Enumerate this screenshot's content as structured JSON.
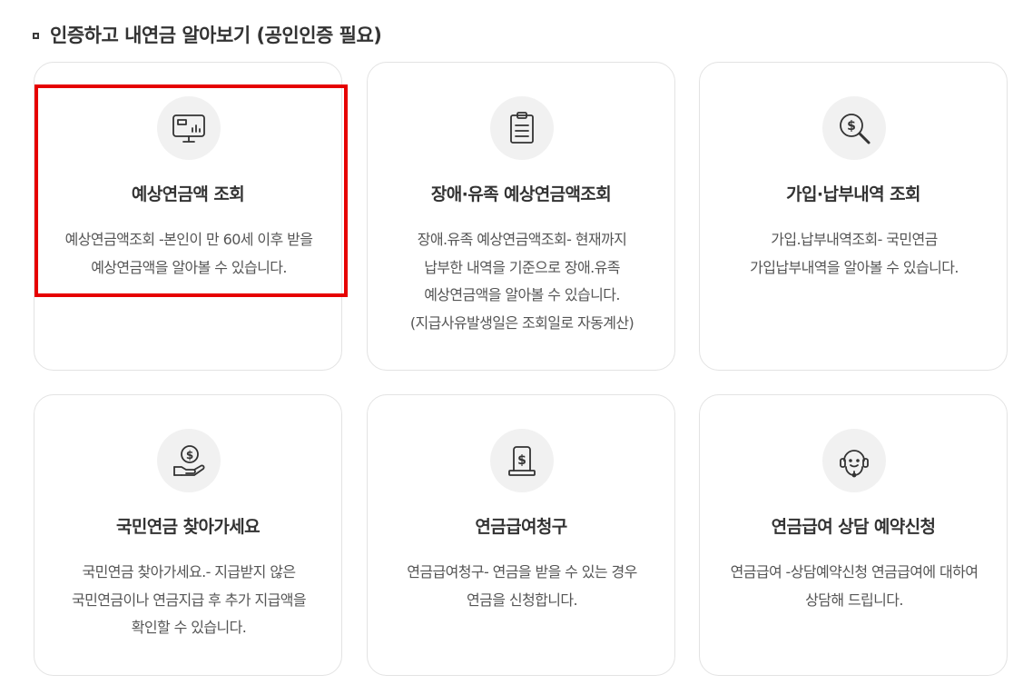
{
  "section": {
    "title": "인증하고 내연금 알아보기 (공인인증 필요)"
  },
  "cards": [
    {
      "icon": "monitor-chart-icon",
      "title": "예상연금액 조회",
      "desc": [
        "예상연금액조회 -본인이 만 60세 이후 받을",
        "예상연금액을 알아볼 수 있습니다."
      ]
    },
    {
      "icon": "clipboard-icon",
      "title": "장애·유족 예상연금액조회",
      "desc": [
        "장애.유족 예상연금액조회- 현재까지",
        "납부한 내역을 기준으로 장애.유족",
        "예상연금액을 알아볼 수 있습니다.",
        "(지급사유발생일은 조회일로 자동계산)"
      ]
    },
    {
      "icon": "dollar-search-icon",
      "title": "가입·납부내역 조회",
      "desc": [
        "가입.납부내역조회- 국민연금",
        "가입납부내역을 알아볼 수 있습니다."
      ]
    },
    {
      "icon": "coin-hand-icon",
      "title": "국민연금 찾아가세요",
      "desc": [
        "국민연금 찾아가세요.- 지급받지 않은",
        "국민연금이나 연금지급 후 추가 지급액을",
        "확인할 수 있습니다."
      ]
    },
    {
      "icon": "dollar-document-icon",
      "title": "연금급여청구",
      "desc": [
        "연금급여청구- 연금을 받을 수 있는 경우",
        "연금을 신청합니다."
      ]
    },
    {
      "icon": "headset-icon",
      "title": "연금급여 상담 예약신청",
      "desc": [
        "연금급여 -상담예약신청 연금급여에 대하여",
        "상담해 드립니다."
      ]
    }
  ],
  "colors": {
    "highlight": "#e60000",
    "card_border": "#e3e3e3",
    "icon_bg": "#f1f1f1"
  }
}
